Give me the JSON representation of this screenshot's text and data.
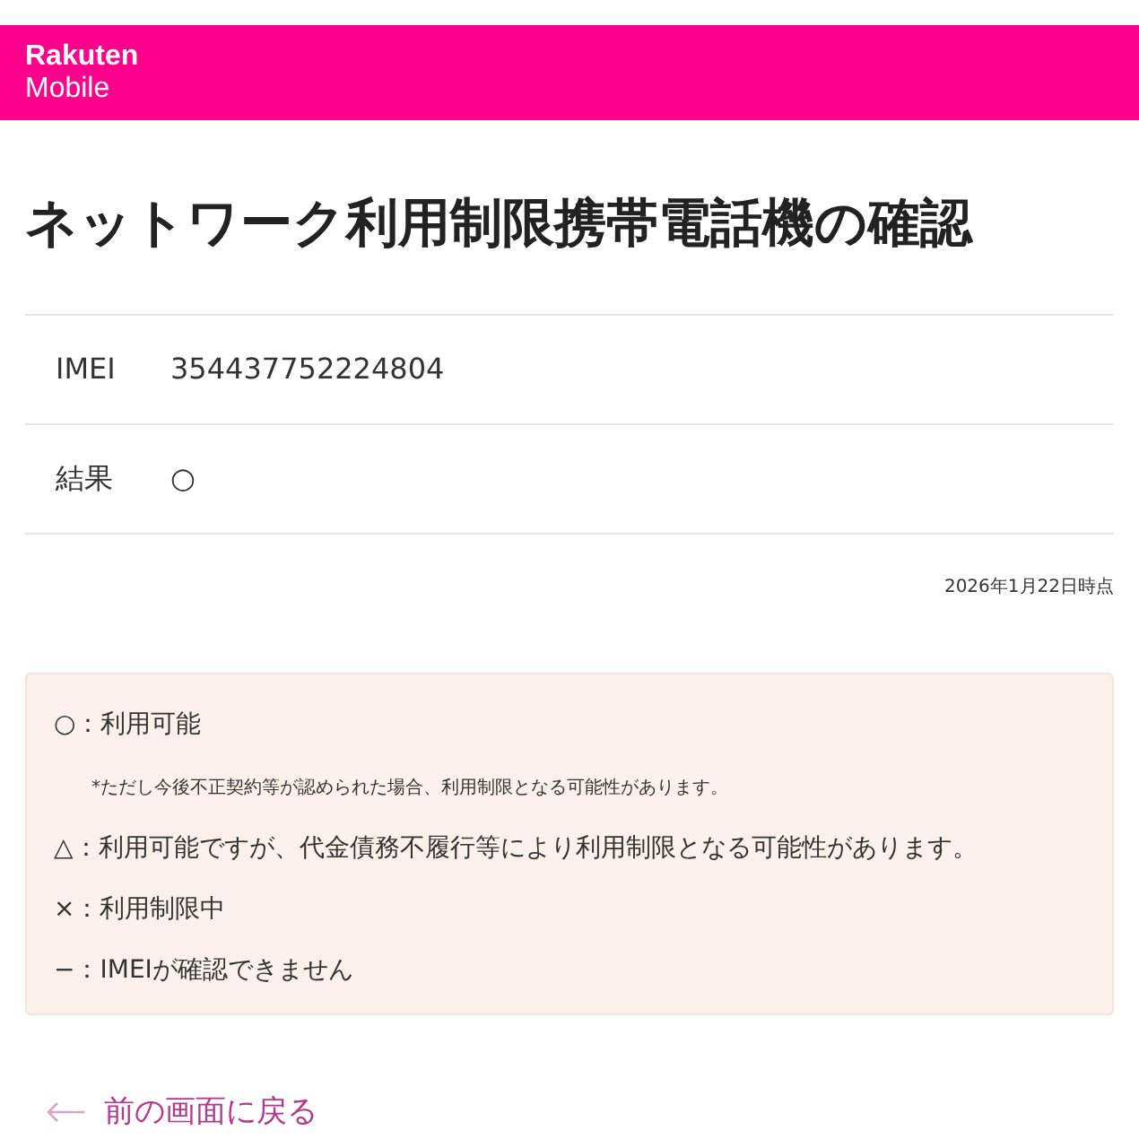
{
  "header": {
    "logo_line_1": "Rakuten",
    "logo_line_2": "Mobile"
  },
  "title": "ネットワーク利用制限携帯電話機の確認",
  "rows": [
    {
      "label": "IMEI",
      "value": "354437752224804"
    },
    {
      "label": "結果",
      "value": "○"
    }
  ],
  "as_of": "2026年1月22日時点",
  "legend": [
    {
      "kind": "main",
      "text": "○：利用可能"
    },
    {
      "kind": "note",
      "text": "*ただし今後不正契約等が認められた場合、利用制限となる可能性があります。"
    },
    {
      "kind": "main",
      "text": "△：利用可能ですが、代金債務不履行等により利用制限となる可能性があります。"
    },
    {
      "kind": "main",
      "text": "×：利用制限中"
    },
    {
      "kind": "main",
      "text": "−：IMEIが確認できません"
    }
  ],
  "back_link": "前の画面に戻る"
}
